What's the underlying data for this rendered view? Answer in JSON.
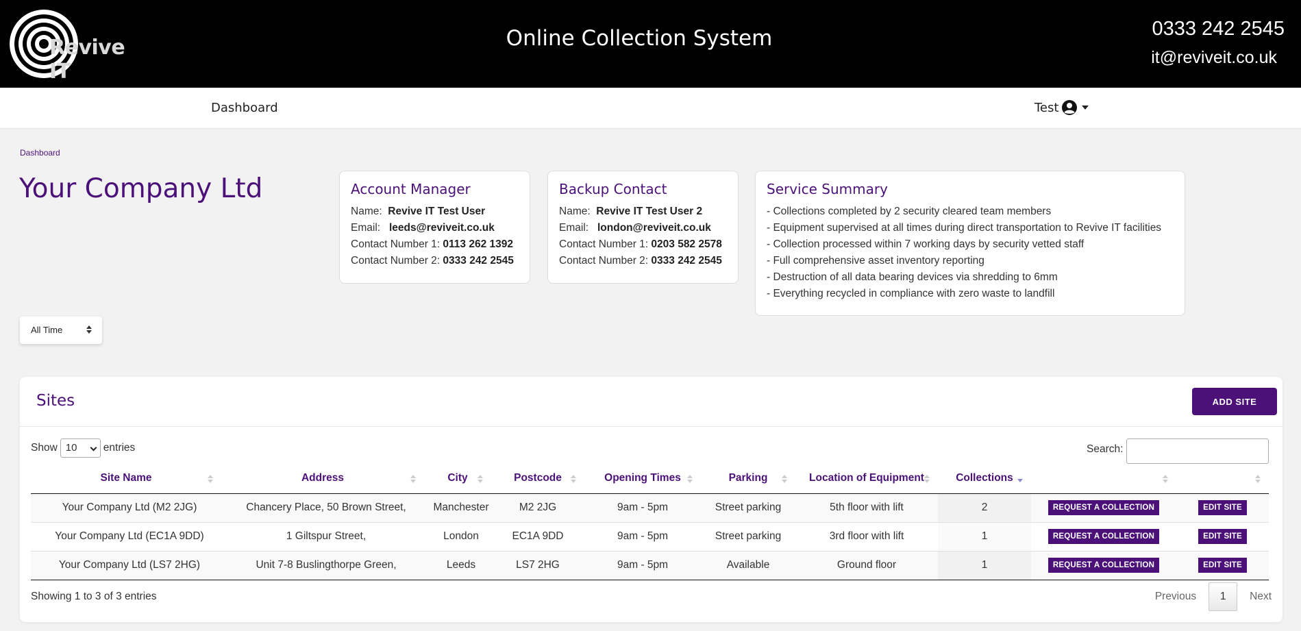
{
  "header": {
    "logo_text": "Revive IT",
    "title": "Online Collection System",
    "phone": "0333 242 2545",
    "email": "it@reviveit.co.uk"
  },
  "nav": {
    "dashboard": "Dashboard",
    "user": "Test"
  },
  "breadcrumb": "Dashboard",
  "company": "Your Company Ltd",
  "account_manager": {
    "title": "Account Manager",
    "name_label": "Name:",
    "name": "Revive IT Test User",
    "email_label": "Email:",
    "email": "leeds@reviveit.co.uk",
    "contact1_label": "Contact Number 1:",
    "contact1": "0113 262 1392",
    "contact2_label": "Contact Number 2:",
    "contact2": "0333 242 2545"
  },
  "backup_contact": {
    "title": "Backup Contact",
    "name_label": "Name:",
    "name": "Revive IT Test User 2",
    "email_label": "Email:",
    "email": "london@reviveit.co.uk",
    "contact1_label": "Contact Number 1:",
    "contact1": "0203 582 2578",
    "contact2_label": "Contact Number 2:",
    "contact2": "0333 242 2545"
  },
  "service_summary": {
    "title": "Service Summary",
    "items": [
      "- Collections completed by 2 security cleared team members",
      "- Equipment supervised at all times during direct transportation to Revive IT facilities",
      "- Collection processed within 7 working days by security vetted staff",
      "- Full comprehensive asset inventory reporting",
      "- Destruction of all data bearing devices via shredding to 6mm",
      "- Everything recycled in compliance with zero waste to landfill"
    ]
  },
  "time_filter": "All Time",
  "sites": {
    "title": "Sites",
    "add_button": "ADD SITE",
    "show_label": "Show",
    "page_length": "10",
    "entries_label": "entries",
    "search_label": "Search:",
    "columns": [
      "Site Name",
      "Address",
      "City",
      "Postcode",
      "Opening Times",
      "Parking",
      "Location of Equipment",
      "Collections",
      "",
      ""
    ],
    "rows": [
      {
        "site": "Your Company Ltd (M2 2JG)",
        "address": "Chancery Place, 50 Brown Street,",
        "city": "Manchester",
        "postcode": "M2 2JG",
        "hours": "9am - 5pm",
        "parking": "Street parking",
        "location": "5th floor with lift",
        "collections": "2",
        "request": "REQUEST A COLLECTION",
        "edit": "EDIT SITE"
      },
      {
        "site": "Your Company Ltd (EC1A 9DD)",
        "address": "1 Giltspur Street,",
        "city": "London",
        "postcode": "EC1A 9DD",
        "hours": "9am - 5pm",
        "parking": "Street parking",
        "location": "3rd floor with lift",
        "collections": "1",
        "request": "REQUEST A COLLECTION",
        "edit": "EDIT SITE"
      },
      {
        "site": "Your Company Ltd (LS7 2HG)",
        "address": "Unit 7-8 Buslingthorpe Green,",
        "city": "Leeds",
        "postcode": "LS7 2HG",
        "hours": "9am - 5pm",
        "parking": "Available",
        "location": "Ground floor",
        "collections": "1",
        "request": "REQUEST A COLLECTION",
        "edit": "EDIT SITE"
      }
    ],
    "info": "Showing 1 to 3 of 3 entries",
    "prev": "Previous",
    "page": "1",
    "next": "Next"
  },
  "colors": {
    "accent": "#4b1178",
    "header_bg": "#000000"
  }
}
